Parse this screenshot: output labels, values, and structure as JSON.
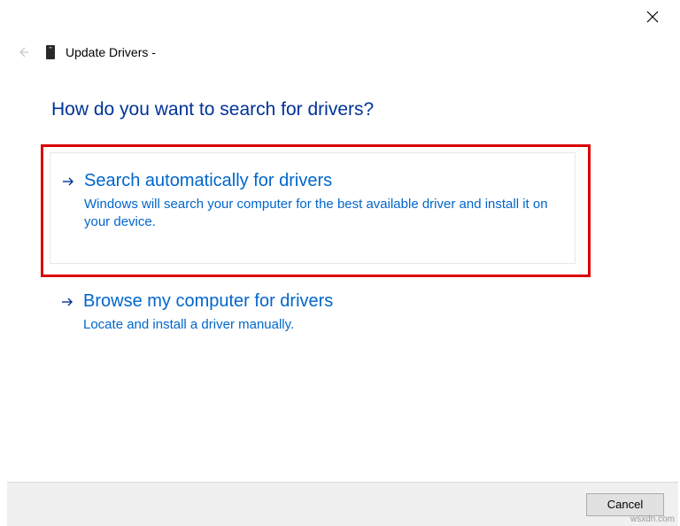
{
  "header": {
    "title": "Update Drivers -"
  },
  "question": "How do you want to search for drivers?",
  "options": [
    {
      "title": "Search automatically for drivers",
      "description": "Windows will search your computer for the best available driver and install it on your device."
    },
    {
      "title": "Browse my computer for drivers",
      "description": "Locate and install a driver manually."
    }
  ],
  "footer": {
    "cancel": "Cancel"
  },
  "watermark": "wsxdn.com"
}
